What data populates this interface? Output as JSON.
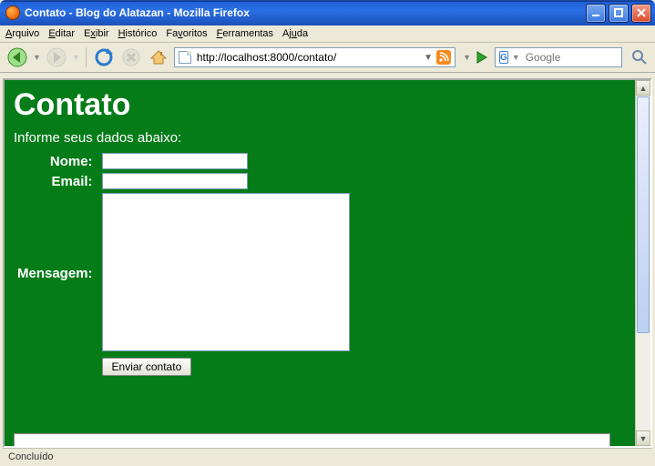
{
  "window": {
    "title": "Contato - Blog do Alatazan - Mozilla Firefox"
  },
  "menubar": {
    "items": [
      {
        "label": "Arquivo",
        "ul": "A"
      },
      {
        "label": "Editar",
        "ul": "E"
      },
      {
        "label": "Exibir",
        "ul": "x"
      },
      {
        "label": "Histórico",
        "ul": "H"
      },
      {
        "label": "Favoritos",
        "ul": "v"
      },
      {
        "label": "Ferramentas",
        "ul": "F"
      },
      {
        "label": "Ajuda",
        "ul": "u"
      }
    ]
  },
  "toolbar": {
    "url": "http://localhost:8000/contato/",
    "search_placeholder": "Google"
  },
  "page": {
    "heading": "Contato",
    "lead": "Informe seus dados abaixo:",
    "labels": {
      "nome": "Nome:",
      "email": "Email:",
      "mensagem": "Mensagem:"
    },
    "fields": {
      "nome": "",
      "email": "",
      "mensagem": ""
    },
    "submit_label": "Enviar contato"
  },
  "status": {
    "text": "Concluído"
  }
}
